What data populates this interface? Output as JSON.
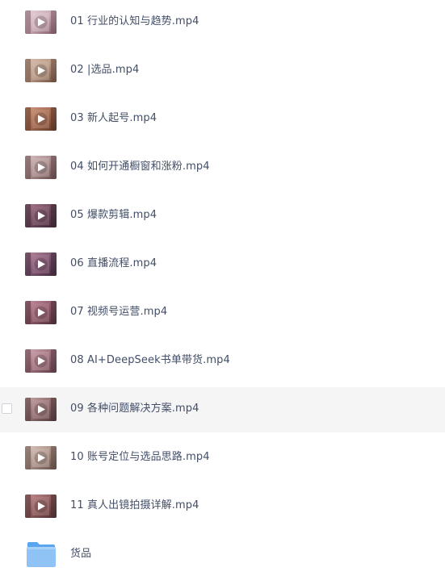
{
  "files": [
    {
      "name": "01 行业的认知与趋势.mp4",
      "type": "video",
      "thumb": [
        "#c9a9b4",
        "#7a5560",
        "#e8d5da"
      ]
    },
    {
      "name": "02 |选品.mp4",
      "type": "video",
      "thumb": [
        "#b89a86",
        "#6b4b3d",
        "#d9c1b1"
      ]
    },
    {
      "name": "03 新人起号.mp4",
      "type": "video",
      "thumb": [
        "#a06a55",
        "#5d3525",
        "#d19b7e"
      ]
    },
    {
      "name": "04 如何开通橱窗和涨粉.mp4",
      "type": "video",
      "thumb": [
        "#a88b8c",
        "#614647",
        "#d8bfbf"
      ]
    },
    {
      "name": "05 爆款剪辑.mp4",
      "type": "video",
      "thumb": [
        "#6d4a5e",
        "#3a2633",
        "#a97a8f"
      ]
    },
    {
      "name": "06 直播流程.mp4",
      "type": "video",
      "thumb": [
        "#7a5570",
        "#40283a",
        "#b8899f"
      ]
    },
    {
      "name": "07 视频号运营.mp4",
      "type": "video",
      "thumb": [
        "#8d5a6a",
        "#4a2c37",
        "#c6909f"
      ]
    },
    {
      "name": "08 AI+DeepSeek书单带货.mp4",
      "type": "video",
      "thumb": [
        "#9a6f7a",
        "#5a3a44",
        "#d4a9b3"
      ]
    },
    {
      "name": "09 各种问题解决方案.mp4",
      "type": "video",
      "thumb": [
        "#8e6c6e",
        "#4c3436",
        "#c9a5a6"
      ],
      "hover": true
    },
    {
      "name": "10 账号定位与选品思路.mp4",
      "type": "video",
      "thumb": [
        "#a98f86",
        "#5e4a44",
        "#dcc8c0"
      ]
    },
    {
      "name": "11 真人出镜拍摄详解.mp4",
      "type": "video",
      "thumb": [
        "#8a5a5c",
        "#4a2e30",
        "#c48e90"
      ]
    },
    {
      "name": "货品",
      "type": "folder",
      "thumb": [
        "#8fc3f5",
        "#5aa6ee",
        "#b9dafa"
      ]
    }
  ]
}
